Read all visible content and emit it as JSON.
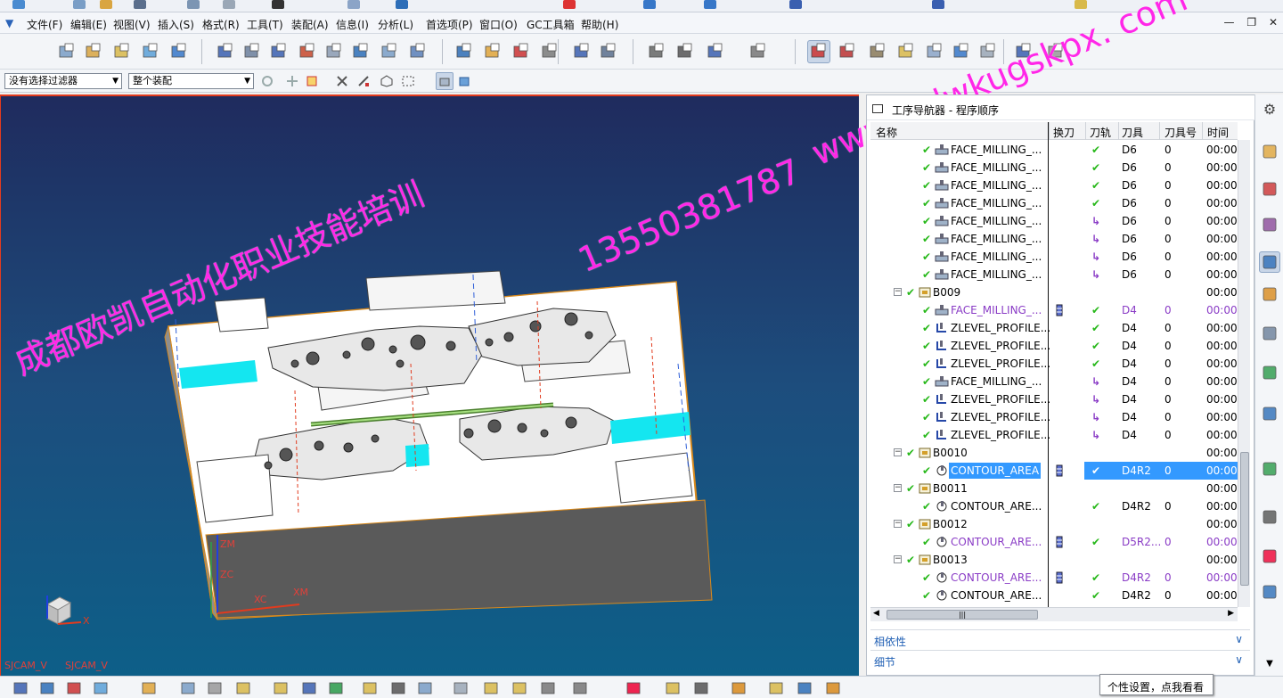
{
  "menu": {
    "items": [
      "文件(F)",
      "编辑(E)",
      "视图(V)",
      "插入(S)",
      "格式(R)",
      "工具(T)",
      "装配(A)",
      "信息(I)",
      "分析(L)",
      "首选项(P)",
      "窗口(O)",
      "GC工具箱",
      "帮助(H)"
    ]
  },
  "filters": {
    "selection_filter": "没有选择过滤器",
    "assembly_scope": "整个装配"
  },
  "viewport": {
    "labels": {
      "view_left": "SJCAM_V",
      "view_right": "SJCAM_V",
      "zm": "ZM",
      "zc": "ZC",
      "xc": "XC",
      "xm": "XM",
      "x": "X"
    }
  },
  "watermark": {
    "company": "成都欧凯自动化职业技能培训",
    "phone": "13550381787",
    "site": "www. cdwkugskpx. com"
  },
  "navigator": {
    "title": "工序导航器 - 程序顺序",
    "columns": {
      "name": "名称",
      "tool_change": "换刀",
      "path": "刀轨",
      "tool": "刀具",
      "tool_number": "刀具号",
      "time": "时间"
    },
    "rows": [
      {
        "name": "FACE_MILLING_...",
        "path": "check",
        "tool": "D6",
        "num": "0",
        "time": "00:00",
        "level": 2,
        "kind": "face"
      },
      {
        "name": "FACE_MILLING_...",
        "path": "check",
        "tool": "D6",
        "num": "0",
        "time": "00:00",
        "level": 2,
        "kind": "face"
      },
      {
        "name": "FACE_MILLING_...",
        "path": "check",
        "tool": "D6",
        "num": "0",
        "time": "00:00",
        "level": 2,
        "kind": "face"
      },
      {
        "name": "FACE_MILLING_...",
        "path": "check",
        "tool": "D6",
        "num": "0",
        "time": "00:00",
        "level": 2,
        "kind": "face"
      },
      {
        "name": "FACE_MILLING_...",
        "path": "arrow",
        "tool": "D6",
        "num": "0",
        "time": "00:00",
        "level": 2,
        "kind": "face"
      },
      {
        "name": "FACE_MILLING_...",
        "path": "arrow",
        "tool": "D6",
        "num": "0",
        "time": "00:00",
        "level": 2,
        "kind": "face"
      },
      {
        "name": "FACE_MILLING_...",
        "path": "arrow",
        "tool": "D6",
        "num": "0",
        "time": "00:00",
        "level": 2,
        "kind": "face"
      },
      {
        "name": "FACE_MILLING_...",
        "path": "arrow",
        "tool": "D6",
        "num": "0",
        "time": "00:00",
        "level": 2,
        "kind": "face"
      },
      {
        "name": "B009",
        "path": "",
        "tool": "",
        "num": "",
        "time": "00:00",
        "level": 1,
        "kind": "group"
      },
      {
        "name": "FACE_MILLING_...",
        "path": "check",
        "tool": "D4",
        "num": "0",
        "time": "00:00",
        "level": 2,
        "kind": "face",
        "purple": true,
        "change": true
      },
      {
        "name": "ZLEVEL_PROFILE...",
        "path": "check",
        "tool": "D4",
        "num": "0",
        "time": "00:00",
        "level": 2,
        "kind": "zlevel"
      },
      {
        "name": "ZLEVEL_PROFILE...",
        "path": "check",
        "tool": "D4",
        "num": "0",
        "time": "00:00",
        "level": 2,
        "kind": "zlevel"
      },
      {
        "name": "ZLEVEL_PROFILE...",
        "path": "check",
        "tool": "D4",
        "num": "0",
        "time": "00:00",
        "level": 2,
        "kind": "zlevel"
      },
      {
        "name": "FACE_MILLING_...",
        "path": "arrow",
        "tool": "D4",
        "num": "0",
        "time": "00:00",
        "level": 2,
        "kind": "face"
      },
      {
        "name": "ZLEVEL_PROFILE...",
        "path": "arrow",
        "tool": "D4",
        "num": "0",
        "time": "00:00",
        "level": 2,
        "kind": "zlevel"
      },
      {
        "name": "ZLEVEL_PROFILE...",
        "path": "arrow",
        "tool": "D4",
        "num": "0",
        "time": "00:00",
        "level": 2,
        "kind": "zlevel"
      },
      {
        "name": "ZLEVEL_PROFILE...",
        "path": "arrow",
        "tool": "D4",
        "num": "0",
        "time": "00:00",
        "level": 2,
        "kind": "zlevel"
      },
      {
        "name": "B0010",
        "path": "",
        "tool": "",
        "num": "",
        "time": "00:00",
        "level": 1,
        "kind": "group"
      },
      {
        "name": "CONTOUR_AREA",
        "path": "check",
        "tool": "D4R2",
        "num": "0",
        "time": "00:00",
        "level": 2,
        "kind": "contour",
        "selected": true,
        "change": true
      },
      {
        "name": "B0011",
        "path": "",
        "tool": "",
        "num": "",
        "time": "00:00",
        "level": 1,
        "kind": "group"
      },
      {
        "name": "CONTOUR_ARE...",
        "path": "check",
        "tool": "D4R2",
        "num": "0",
        "time": "00:00",
        "level": 2,
        "kind": "contour"
      },
      {
        "name": "B0012",
        "path": "",
        "tool": "",
        "num": "",
        "time": "00:00",
        "level": 1,
        "kind": "group"
      },
      {
        "name": "CONTOUR_ARE...",
        "path": "check",
        "tool": "D5R2...",
        "num": "0",
        "time": "00:00",
        "level": 2,
        "kind": "contour",
        "purple": true,
        "change": true
      },
      {
        "name": "B0013",
        "path": "",
        "tool": "",
        "num": "",
        "time": "00:00",
        "level": 1,
        "kind": "group"
      },
      {
        "name": "CONTOUR_ARE...",
        "path": "check",
        "tool": "D4R2",
        "num": "0",
        "time": "00:00",
        "level": 2,
        "kind": "contour",
        "purple": true,
        "change": true
      },
      {
        "name": "CONTOUR_ARE...",
        "path": "check",
        "tool": "D4R2",
        "num": "0",
        "time": "00:00",
        "level": 2,
        "kind": "contour"
      }
    ],
    "sections": {
      "dependencies": "相依性",
      "details": "细节"
    }
  },
  "tooltip": "个性设置，点我看看",
  "colors": {
    "accent": "#3399ff",
    "viewport_top": "#1f2b5e",
    "viewport_bottom": "#0d5f88",
    "watermark": "#ff27e8",
    "check": "#27b81a",
    "purple": "#8a3cc6"
  }
}
